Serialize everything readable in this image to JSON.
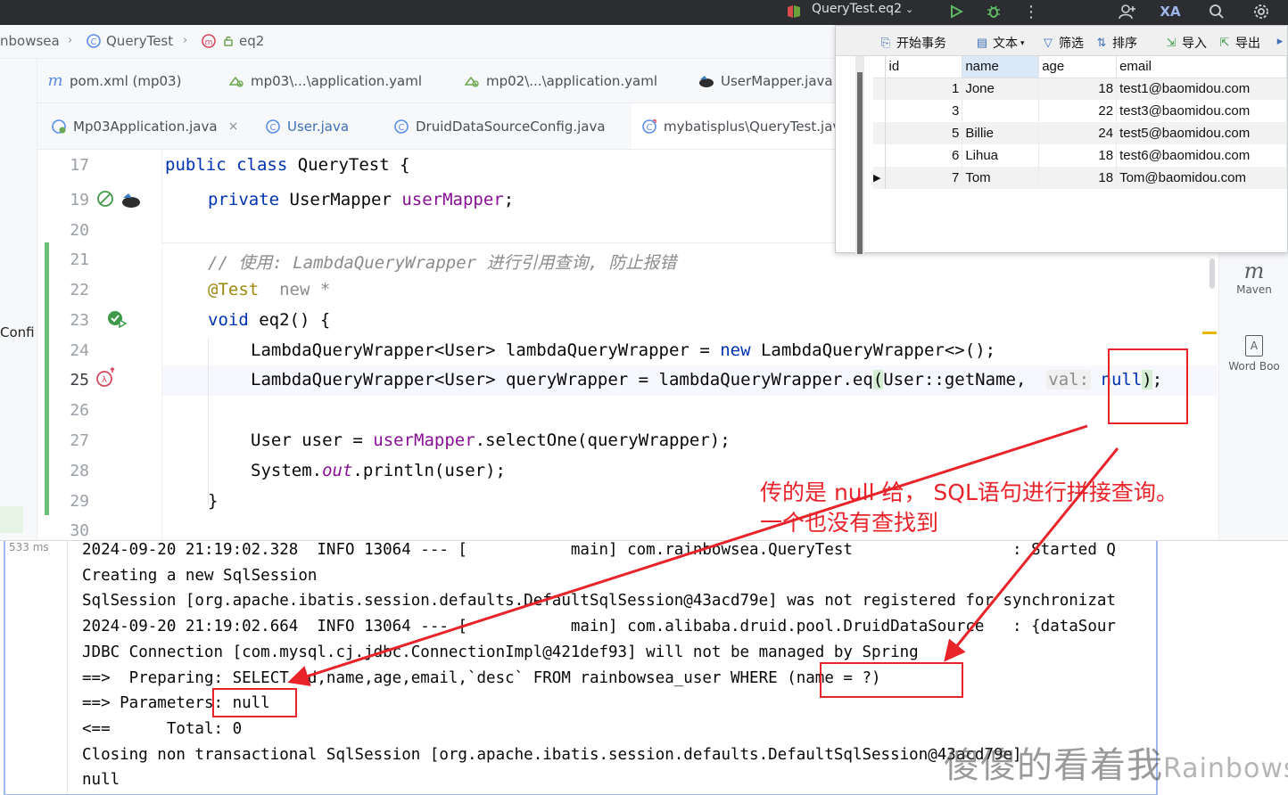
{
  "topbar": {
    "run_config": "QueryTest.eq2",
    "icons": [
      "run-config-icon",
      "chevron-down-icon",
      "run-icon",
      "debug-icon",
      "more-icon",
      "add-user-icon",
      "translate-icon",
      "search-icon",
      "settings-icon"
    ]
  },
  "breadcrumb": {
    "items": [
      "nbowsea",
      "QueryTest",
      "eq2"
    ]
  },
  "left_strip": {
    "config_label": "Confi"
  },
  "tabs_row1": [
    {
      "label": "pom.xml (mp03)",
      "icon": "maven-icon"
    },
    {
      "label": "mp03\\...\\application.yaml",
      "icon": "yaml-icon"
    },
    {
      "label": "mp02\\...\\application.yaml",
      "icon": "yaml-icon"
    },
    {
      "label": "UserMapper.java",
      "icon": "mybatis-bird-icon"
    }
  ],
  "tabs_row2": [
    {
      "label": "Mp03Application.java",
      "icon": "spring-class-icon",
      "close": "×"
    },
    {
      "label": "User.java",
      "icon": "class-icon"
    },
    {
      "label": "DruidDataSourceConfig.java",
      "icon": "class-icon"
    },
    {
      "label": "mybatisplus\\QueryTest.jav",
      "icon": "test-class-icon"
    }
  ],
  "editor": {
    "line_numbers": [
      "17",
      "19",
      "20",
      "21",
      "22",
      "23",
      "24",
      "25",
      "26",
      "27",
      "28",
      "29",
      "30"
    ],
    "lines": {
      "l17": {
        "kw": "public class",
        "rest": " QueryTest {"
      },
      "l19": {
        "kw": "private",
        "type": " UserMapper ",
        "field": "userMapper",
        "end": ";"
      },
      "l21": {
        "comment": "// 使用: LambdaQueryWrapper 进行引用查询, 防止报错"
      },
      "l22": {
        "annotation": "@Test",
        "hint": "new *"
      },
      "l23": {
        "kw": "void",
        "rest": " eq2() {"
      },
      "l24": {
        "a": "LambdaQueryWrapper<User> lambdaQueryWrapper = ",
        "kw": "new",
        "b": " LambdaQueryWrapper<>();"
      },
      "l25": {
        "a": "LambdaQueryWrapper<User> queryWrapper = lambdaQueryWrapper.eq",
        "p1": "(",
        "b": "User::getName, ",
        "hint": "val:",
        "kw": "null",
        "p2": ")",
        "end": ";"
      },
      "l27": {
        "a": "User user = ",
        "field": "userMapper",
        "b": ".selectOne(queryWrapper);"
      },
      "l28": {
        "a": "System.",
        "stat": "out",
        "b": ".println(user);"
      },
      "l29": {
        "a": "}"
      }
    }
  },
  "right_tools": [
    {
      "label": "Maven",
      "glyph": "m"
    },
    {
      "label": "Word Boo",
      "glyph": "A"
    }
  ],
  "db_panel": {
    "toolbar": [
      "开始事务",
      "文本",
      "筛选",
      "排序",
      "导入",
      "导出"
    ],
    "columns": [
      "id",
      "name",
      "age",
      "email"
    ],
    "rows": [
      {
        "id": "1",
        "name": "Jone",
        "age": "18",
        "email": "test1@baomidou.com"
      },
      {
        "id": "3",
        "name": "",
        "age": "22",
        "email": "test3@baomidou.com"
      },
      {
        "id": "5",
        "name": "Billie",
        "age": "24",
        "email": "test5@baomidou.com"
      },
      {
        "id": "6",
        "name": "Lihua",
        "age": "18",
        "email": "test6@baomidou.com"
      },
      {
        "id": "7",
        "name": "Tom",
        "age": "18",
        "email": "Tom@baomidou.com"
      }
    ],
    "row_marker": "▶"
  },
  "console": {
    "timing": "533 ms",
    "lines": [
      "2024-09-20 21:19:02.328  INFO 13064 --- [           main] com.rainbowsea.QueryTest                 : Started Q",
      "Creating a new SqlSession",
      "SqlSession [org.apache.ibatis.session.defaults.DefaultSqlSession@43acd79e] was not registered for synchronizat",
      "2024-09-20 21:19:02.664  INFO 13064 --- [           main] com.alibaba.druid.pool.DruidDataSource   : {dataSour",
      "JDBC Connection [com.mysql.cj.jdbc.ConnectionImpl@421def93] will not be managed by Spring",
      "==>  Preparing: SELECT id,name,age,email,`desc` FROM rainbowsea_user WHERE (name = ?)",
      "==> Parameters: null",
      "<==      Total: 0",
      "Closing non transactional SqlSession [org.apache.ibatis.session.defaults.DefaultSqlSession@43acd79e]",
      "null"
    ]
  },
  "annotation": {
    "line1": "传的是 null 给， SQL语句进行拼接查询。",
    "line2": "一个也没有查找到",
    "color": "#e8232a"
  },
  "watermark": {
    "cn": "傻傻的看着我",
    "en": "Rainbowsea"
  }
}
